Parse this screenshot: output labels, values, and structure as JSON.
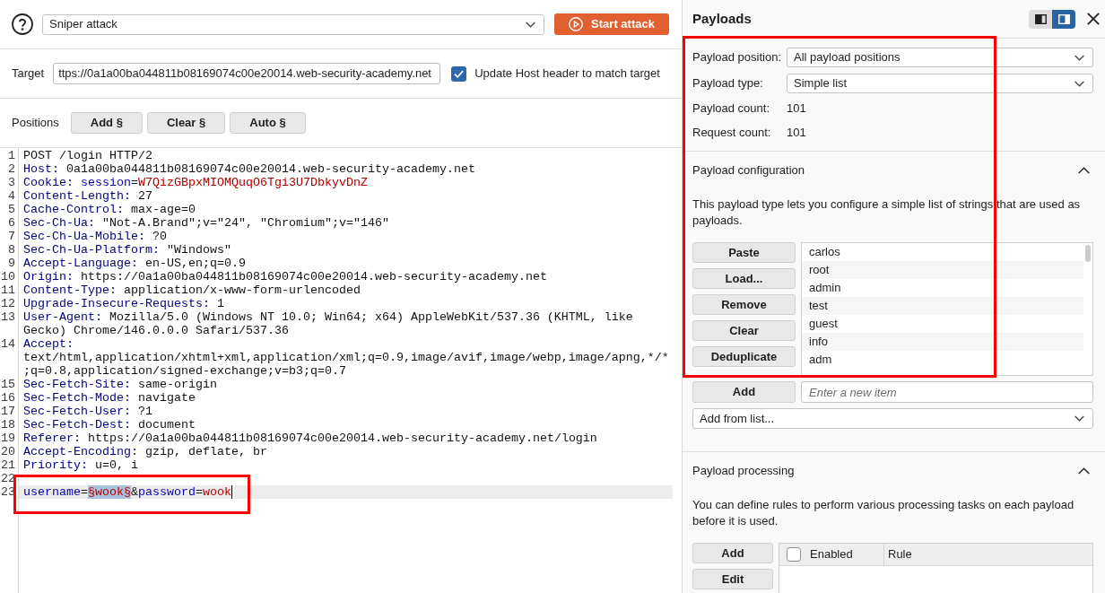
{
  "toolbar": {
    "attack_type": "Sniper attack",
    "start_button": "Start attack"
  },
  "target": {
    "label": "Target",
    "value": "ttps://0a1a00ba044811b08169074c00e20014.web-security-academy.net",
    "update_host": {
      "label": "Update Host header to match target",
      "checked": true
    }
  },
  "positions": {
    "label": "Positions",
    "buttons": [
      "Add §",
      "Clear §",
      "Auto §"
    ]
  },
  "request": {
    "lines": [
      {
        "number": "1",
        "current": false,
        "framed": false,
        "tokens": [
          {
            "kind": "text",
            "text": "POST /login HTTP/2"
          }
        ]
      },
      {
        "number": "2",
        "current": false,
        "framed": false,
        "tokens": [
          {
            "kind": "header",
            "text": "Host:"
          },
          {
            "kind": "text",
            "text": " 0a1a00ba044811b08169074c00e20014.web-security-academy.net"
          }
        ]
      },
      {
        "number": "3",
        "current": false,
        "framed": false,
        "tokens": [
          {
            "kind": "header",
            "text": "Cookie: "
          },
          {
            "kind": "param",
            "text": "session"
          },
          {
            "kind": "text",
            "text": "="
          },
          {
            "kind": "value",
            "text": "W7QizGBpxMIOMQuqO6Tgi3U7DbkyvDnZ"
          }
        ]
      },
      {
        "number": "4",
        "current": false,
        "framed": false,
        "tokens": [
          {
            "kind": "header",
            "text": "Content-Length:"
          },
          {
            "kind": "text",
            "text": " 27"
          }
        ]
      },
      {
        "number": "5",
        "current": false,
        "framed": false,
        "tokens": [
          {
            "kind": "header",
            "text": "Cache-Control:"
          },
          {
            "kind": "text",
            "text": " max-age=0"
          }
        ]
      },
      {
        "number": "6",
        "current": false,
        "framed": false,
        "tokens": [
          {
            "kind": "header",
            "text": "Sec-Ch-Ua:"
          },
          {
            "kind": "text",
            "text": " \"Not-A.Brand\";v=\"24\", \"Chromium\";v=\"146\""
          }
        ]
      },
      {
        "number": "7",
        "current": false,
        "framed": false,
        "tokens": [
          {
            "kind": "header",
            "text": "Sec-Ch-Ua-Mobile:"
          },
          {
            "kind": "text",
            "text": " ?0"
          }
        ]
      },
      {
        "number": "8",
        "current": false,
        "framed": false,
        "tokens": [
          {
            "kind": "header",
            "text": "Sec-Ch-Ua-Platform:"
          },
          {
            "kind": "text",
            "text": " \"Windows\""
          }
        ]
      },
      {
        "number": "9",
        "current": false,
        "framed": false,
        "tokens": [
          {
            "kind": "header",
            "text": "Accept-Language:"
          },
          {
            "kind": "text",
            "text": " en-US,en;q=0.9"
          }
        ]
      },
      {
        "number": "10",
        "current": false,
        "framed": false,
        "tokens": [
          {
            "kind": "header",
            "text": "Origin:"
          },
          {
            "kind": "text",
            "text": " https://0a1a00ba044811b08169074c00e20014.web-security-academy.net"
          }
        ]
      },
      {
        "number": "11",
        "current": false,
        "framed": false,
        "tokens": [
          {
            "kind": "header",
            "text": "Content-Type:"
          },
          {
            "kind": "text",
            "text": " application/x-www-form-urlencoded"
          }
        ]
      },
      {
        "number": "12",
        "current": false,
        "framed": false,
        "tokens": [
          {
            "kind": "header",
            "text": "Upgrade-Insecure-Requests:"
          },
          {
            "kind": "text",
            "text": " 1"
          }
        ]
      },
      {
        "number": "13",
        "current": false,
        "framed": false,
        "tokens": [
          {
            "kind": "header",
            "text": "User-Agent:"
          },
          {
            "kind": "text",
            "text": " Mozilla/5.0 (Windows NT 10.0; Win64; x64) AppleWebKit/537.36 (KHTML, like Gecko) Chrome/146.0.0.0 Safari/537.36"
          }
        ]
      },
      {
        "number": "14",
        "current": false,
        "framed": false,
        "tokens": [
          {
            "kind": "header",
            "text": "Accept:"
          },
          {
            "kind": "text",
            "text": " text/html,application/xhtml+xml,application/xml;q=0.9,image/avif,image/webp,image/apng,*/*;q=0.8,application/signed-exchange;v=b3;q=0.7"
          }
        ]
      },
      {
        "number": "15",
        "current": false,
        "framed": false,
        "tokens": [
          {
            "kind": "header",
            "text": "Sec-Fetch-Site:"
          },
          {
            "kind": "text",
            "text": " same-origin"
          }
        ]
      },
      {
        "number": "16",
        "current": false,
        "framed": false,
        "tokens": [
          {
            "kind": "header",
            "text": "Sec-Fetch-Mode:"
          },
          {
            "kind": "text",
            "text": " navigate"
          }
        ]
      },
      {
        "number": "17",
        "current": false,
        "framed": false,
        "tokens": [
          {
            "kind": "header",
            "text": "Sec-Fetch-User:"
          },
          {
            "kind": "text",
            "text": " ?1"
          }
        ]
      },
      {
        "number": "18",
        "current": false,
        "framed": false,
        "tokens": [
          {
            "kind": "header",
            "text": "Sec-Fetch-Dest:"
          },
          {
            "kind": "text",
            "text": " document"
          }
        ]
      },
      {
        "number": "19",
        "current": false,
        "framed": false,
        "tokens": [
          {
            "kind": "header",
            "text": "Referer:"
          },
          {
            "kind": "text",
            "text": " https://0a1a00ba044811b08169074c00e20014.web-security-academy.net/login"
          }
        ]
      },
      {
        "number": "20",
        "current": false,
        "framed": false,
        "tokens": [
          {
            "kind": "header",
            "text": "Accept-Encoding:"
          },
          {
            "kind": "text",
            "text": " gzip, deflate, br"
          }
        ]
      },
      {
        "number": "21",
        "current": false,
        "framed": false,
        "tokens": [
          {
            "kind": "header",
            "text": "Priority:"
          },
          {
            "kind": "text",
            "text": " u=0, i"
          }
        ]
      },
      {
        "number": "22",
        "current": false,
        "framed": false
      },
      {
        "number": "23",
        "current": true,
        "framed": true,
        "tokens": [
          {
            "kind": "param",
            "text": "username"
          },
          {
            "kind": "text",
            "text": "="
          },
          {
            "kind": "position",
            "text": "§wook§"
          },
          {
            "kind": "text",
            "text": "&"
          },
          {
            "kind": "param",
            "text": "password"
          },
          {
            "kind": "text",
            "text": "="
          },
          {
            "kind": "value",
            "text": "wook"
          }
        ]
      }
    ]
  },
  "payloads": {
    "title": "Payloads",
    "view_toggle": [
      {
        "selected": false
      },
      {
        "selected": true
      }
    ],
    "settings": {
      "framed": true,
      "fields": [
        {
          "label": "Payload position:",
          "kind": "select",
          "value": "All payload positions"
        },
        {
          "label": "Payload type:",
          "kind": "select",
          "value": "Simple list"
        },
        {
          "label": "Payload count:",
          "kind": "text",
          "value": "101"
        },
        {
          "label": "Request count:",
          "kind": "text",
          "value": "101"
        }
      ]
    },
    "configuration": {
      "title": "Payload configuration",
      "expanded": true,
      "description": "This payload type lets you configure a simple list of strings that are used as payloads.",
      "buttons": [
        "Paste",
        "Load...",
        "Remove",
        "Clear",
        "Deduplicate"
      ],
      "items": [
        "carlos",
        "root",
        "admin",
        "test",
        "guest",
        "info",
        "adm"
      ],
      "add_button": "Add",
      "new_item": {
        "placeholder": "Enter a new item"
      },
      "add_from_list": "Add from list..."
    },
    "processing": {
      "title": "Payload processing",
      "expanded": true,
      "description": "You can define rules to perform various processing tasks on each payload before it is used.",
      "buttons": [
        "Add",
        "Edit"
      ],
      "columns": [
        {
          "kind": "checkbox",
          "label": "Enabled",
          "checked": false
        },
        {
          "kind": "text",
          "label": "Rule"
        }
      ]
    }
  }
}
